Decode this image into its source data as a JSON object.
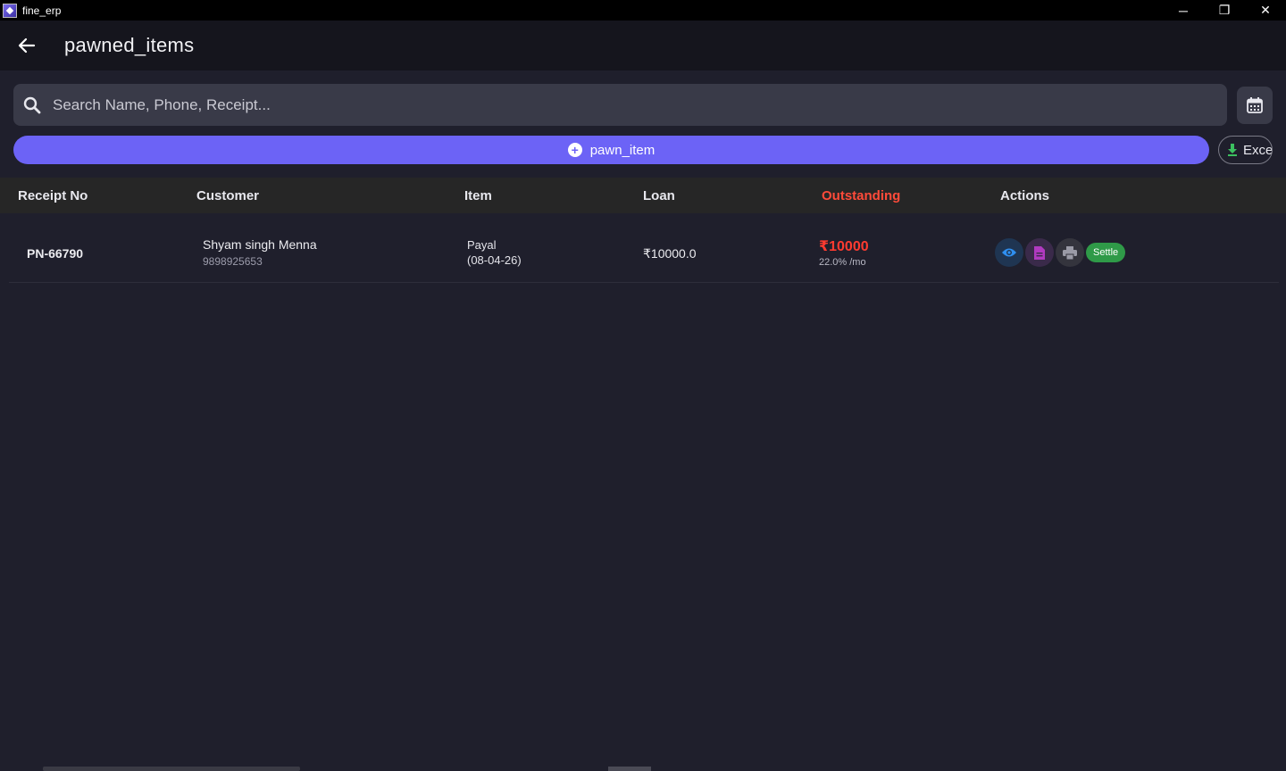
{
  "window": {
    "title": "fine_erp",
    "controls": {
      "minimize": "─",
      "restore": "❐",
      "close": "✕"
    }
  },
  "appbar": {
    "title": "pawned_items"
  },
  "search": {
    "placeholder": "Search Name, Phone, Receipt..."
  },
  "toolbar": {
    "pawn_label": "pawn_item",
    "excel_label": "Excel"
  },
  "table": {
    "headers": {
      "receipt": "Receipt No",
      "customer": "Customer",
      "item": "Item",
      "loan": "Loan",
      "outstanding": "Outstanding",
      "actions": "Actions"
    },
    "rows": [
      {
        "receipt": "PN-66790",
        "customer_name": "Shyam singh Menna",
        "customer_phone": "9898925653",
        "item_name": "Payal",
        "item_date": "(08-04-26)",
        "loan": "₹10000.0",
        "outstanding": "₹10000",
        "rate": "22.0% /mo",
        "settle_label": "Settle"
      }
    ]
  },
  "colors": {
    "accent": "#6c63f6",
    "outstanding": "#ff3b30",
    "settle": "#2f9a48",
    "view_icon": "#2f8ff0",
    "doc_icon": "#b03ac0"
  },
  "icons": {
    "back": "arrow-left-icon",
    "search": "search-icon",
    "calendar": "calendar-icon",
    "add": "plus-circle-icon",
    "download": "download-icon",
    "view": "eye-icon",
    "doc": "document-icon",
    "print": "printer-icon"
  }
}
